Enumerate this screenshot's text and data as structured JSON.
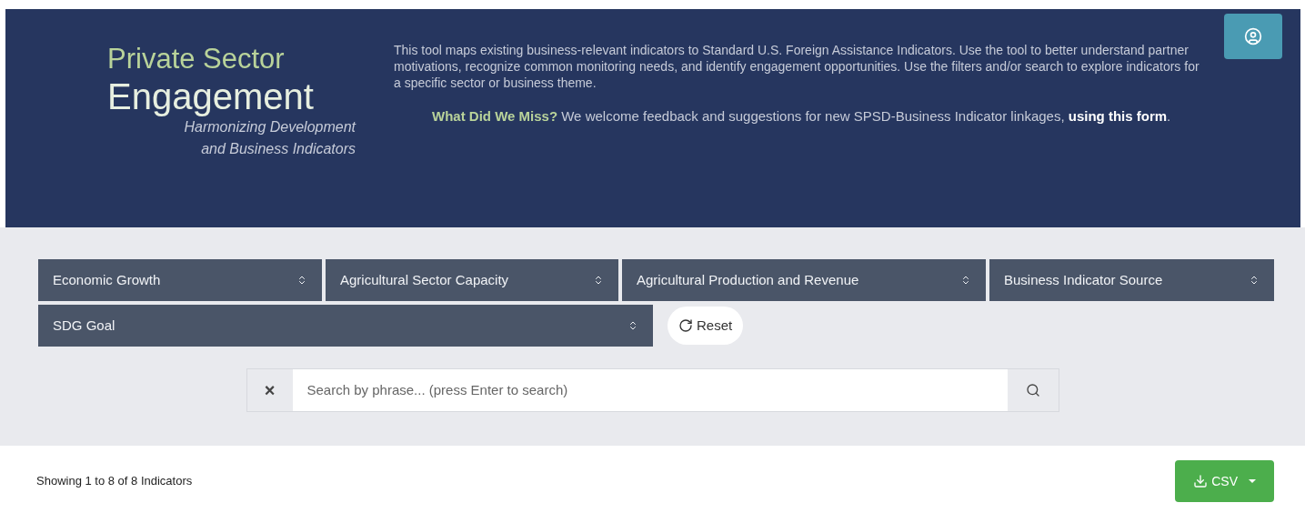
{
  "header": {
    "title_line_1": "Private Sector",
    "title_line_2": "Engagement",
    "subtitle": "Harmonizing Development and Business Indicators",
    "description": "This tool maps existing business-relevant indicators to Standard U.S. Foreign Assistance Indicators. Use the tool to better understand partner motivations, recognize common monitoring needs, and identify engagement opportunities. Use the filters and/or search to explore indicators for a specific sector or business theme.",
    "feedback": {
      "lead": "What Did We Miss?",
      "text": " We welcome feedback and suggestions for new SPSD-Business Indicator linkages, ",
      "link": "using this form",
      "tail": "."
    }
  },
  "filters": [
    {
      "label": "Economic Growth"
    },
    {
      "label": "Agricultural Sector Capacity"
    },
    {
      "label": "Agricultural Production and Revenue"
    },
    {
      "label": "Business Indicator Source"
    },
    {
      "label": "SDG Goal"
    }
  ],
  "reset_button": "Reset",
  "search": {
    "clear": "×",
    "placeholder": "Search by phrase... (press Enter to search)"
  },
  "results": {
    "summary": "Showing 1 to 8 of 8 Indicators",
    "export_button": "CSV"
  }
}
